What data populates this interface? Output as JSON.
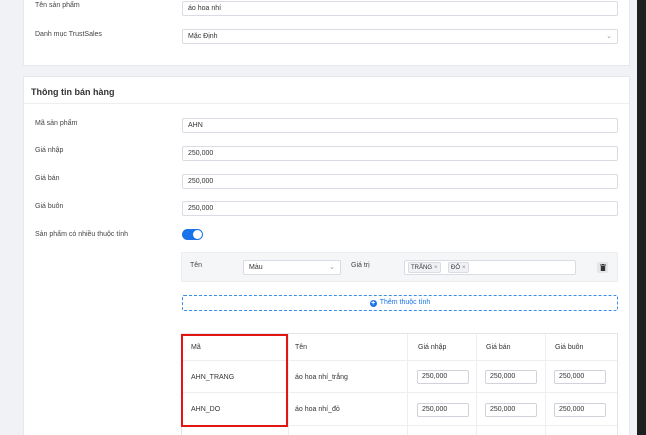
{
  "product_info": {
    "name_label": "Tên sản phẩm",
    "name_value": "áo hoa nhí",
    "category_label": "Danh mục TrustSales",
    "category_value": "Mặc Định"
  },
  "sales_info": {
    "title": "Thông tin bán hàng",
    "fields": [
      {
        "label": "Mã sản phẩm",
        "value": "AHN"
      },
      {
        "label": "Giá nhập",
        "value": "250,000"
      },
      {
        "label": "Giá bán",
        "value": "250,000"
      },
      {
        "label": "Giá buôn",
        "value": "250,000"
      }
    ],
    "multi_attr_label": "Sản phẩm có nhiều thuộc tính",
    "multi_attr_enabled": true
  },
  "attribute": {
    "name_label": "Tên",
    "name_value": "Màu",
    "values_label": "Giá trị",
    "values": [
      "TRẮNG",
      "ĐỎ"
    ],
    "add_button": "Thêm thuộc tính"
  },
  "variants": {
    "headers": [
      "Mã",
      "Tên",
      "Giá nhập",
      "Giá bán",
      "Giá buôn"
    ],
    "rows": [
      {
        "code": "AHN_TRANG",
        "name": "áo hoa nhí_trắng",
        "import_price": "250,000",
        "sell_price": "250,000",
        "wholesale_price": "250,000"
      },
      {
        "code": "AHN_DO",
        "name": "áo hoa nhí_đỏ",
        "import_price": "250,000",
        "sell_price": "250,000",
        "wholesale_price": "250,000"
      }
    ]
  },
  "colors": {
    "accent": "#1a73e8",
    "highlight": "#e31414"
  }
}
